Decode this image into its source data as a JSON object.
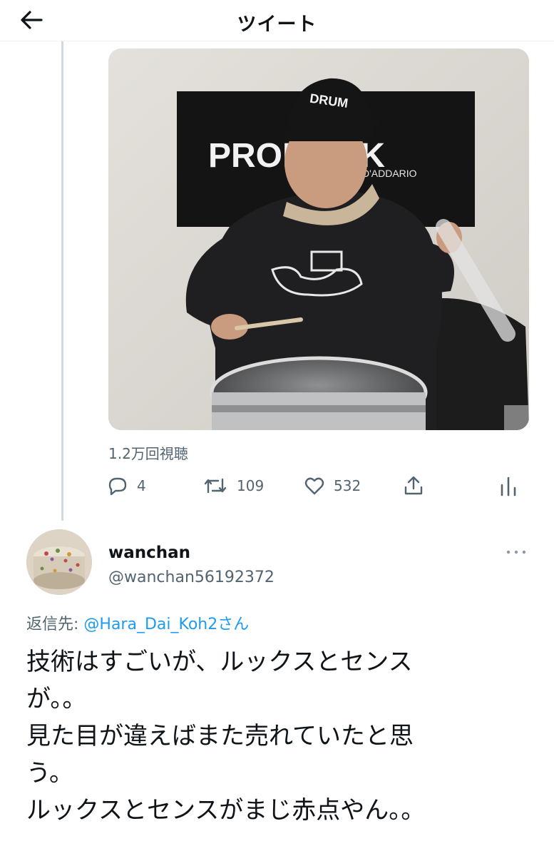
{
  "header": {
    "title": "ツイート",
    "back_icon": "arrow-left-icon"
  },
  "video": {
    "banner_text": "PROMARK",
    "banner_sub": "D'ADDARIO",
    "cap_text": "DRUM"
  },
  "stats": {
    "views": "1.2万回視聴"
  },
  "actions": {
    "reply_count": "4",
    "retweet_count": "109",
    "like_count": "532"
  },
  "reply": {
    "display_name": "wanchan",
    "handle": "@wanchan56192372",
    "reply_to_prefix": "返信先: ",
    "reply_to_mention": "@Hara_Dai_Koh2",
    "reply_to_suffix": "さん",
    "text": "技術はすごいが、ルックスとセンス\nが。。\n見た目が違えばまた売れていたと思\nう。\nルックスとセンスがまじ赤点やん。。"
  },
  "colors": {
    "link": "#1d9bf0",
    "secondary": "#536471",
    "text": "#0f1419",
    "thread_line": "#cfd9de"
  }
}
